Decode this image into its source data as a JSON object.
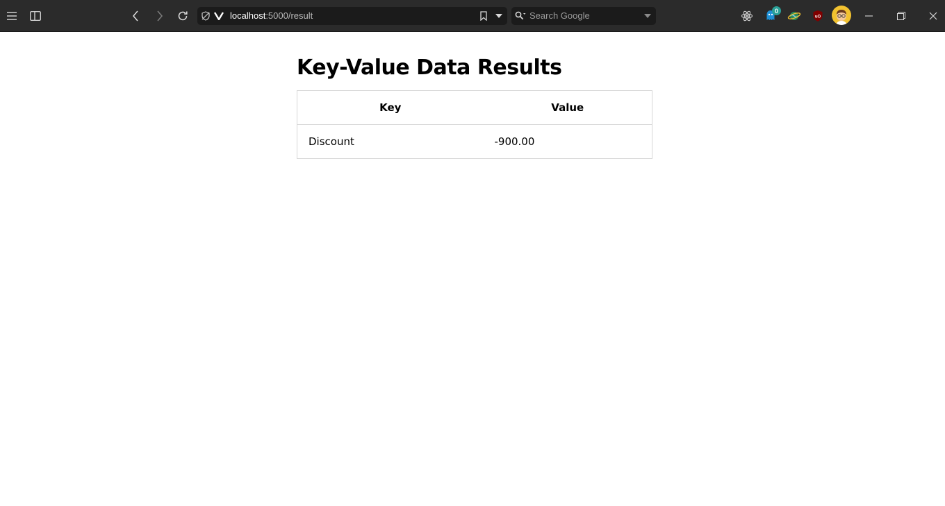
{
  "browser": {
    "address": {
      "host": "localhost",
      "rest": ":5000/result"
    },
    "search": {
      "placeholder": "Search Google"
    },
    "extensions": [
      {
        "icon": "react-devtools-icon"
      },
      {
        "icon": "ghostery-icon",
        "badge": "0"
      },
      {
        "icon": "extension-globe-icon"
      },
      {
        "icon": "ublock-origin-icon"
      }
    ],
    "avatar_icon": "profile-avatar"
  },
  "page": {
    "title": "Key-Value Data Results",
    "table": {
      "headers": [
        "Key",
        "Value"
      ],
      "rows": [
        {
          "key": "Discount",
          "value": "-900.00"
        }
      ]
    }
  }
}
